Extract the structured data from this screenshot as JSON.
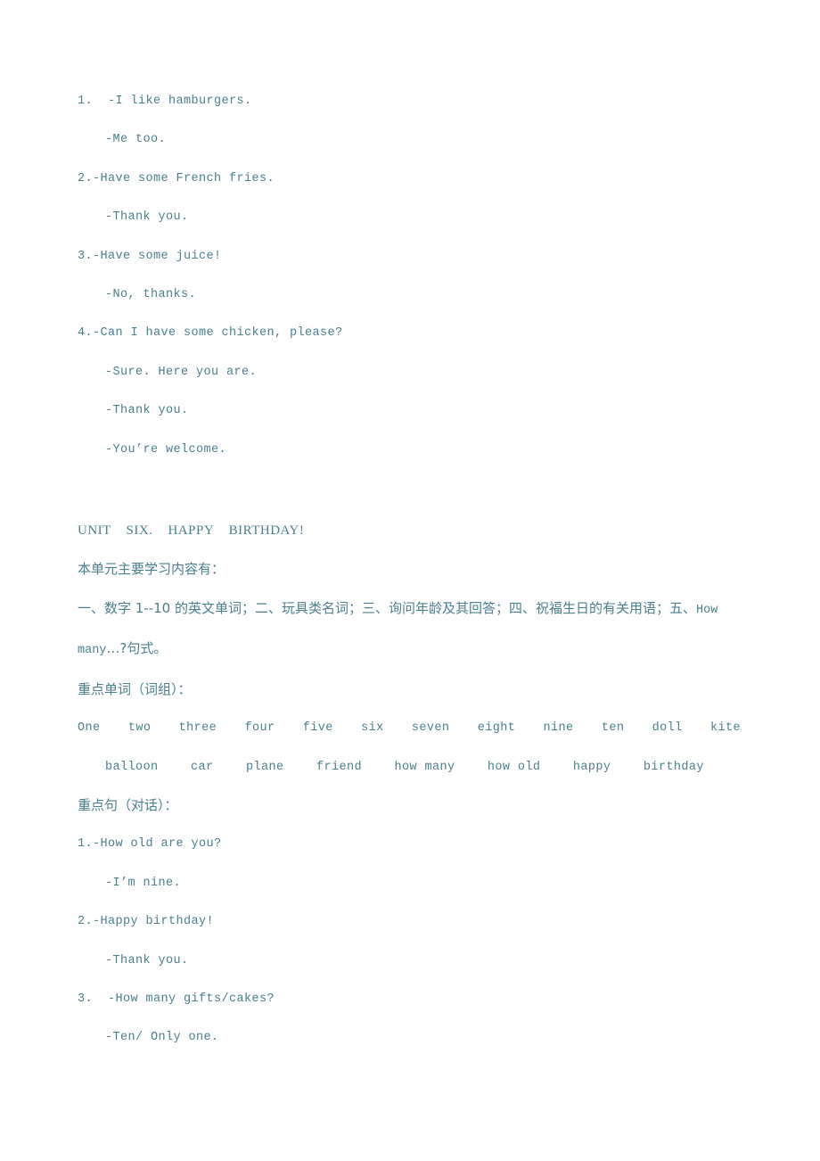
{
  "document": {
    "text_color": "#4d7f8e",
    "background_color": "#ffffff"
  },
  "dialogue_block_1": {
    "items": [
      {
        "prompt": "1.  -I like hamburgers.",
        "replies": [
          "-Me too."
        ]
      },
      {
        "prompt": "2.-Have some French fries.",
        "replies": [
          "-Thank you."
        ]
      },
      {
        "prompt": "3.-Have some juice!",
        "replies": [
          "-No, thanks."
        ]
      },
      {
        "prompt": "4.-Can I have some chicken, please?",
        "replies": [
          "-Sure. Here you are.",
          "-Thank you.",
          "-You’re welcome."
        ]
      }
    ]
  },
  "unit": {
    "heading": "UNIT    SIX.    HAPPY    BIRTHDAY!",
    "intro_label": "本单元主要学习内容有：",
    "contents_part1": "一、数字 1--10 的英文单词；二、玩具类名词；三、询问年龄及其回答；四、祝福生日的有关用语；五、",
    "contents_part2_en": "How many",
    "contents_part2_cn": "…?句式。"
  },
  "vocabulary": {
    "label": "重点单词（词组）：",
    "row1": [
      "One",
      "two",
      "three",
      "four",
      "five",
      "six",
      "seven",
      "eight",
      "nine",
      "ten",
      "doll",
      "kite"
    ],
    "row2": [
      "balloon",
      "car",
      "plane",
      "friend",
      "how many",
      "how old",
      "happy",
      "birthday"
    ]
  },
  "dialogue_block_2": {
    "label": "重点句（对话）：",
    "items": [
      {
        "prompt": "1.-How old are you?",
        "replies": [
          "-I’m nine."
        ]
      },
      {
        "prompt": "2.-Happy birthday!",
        "replies": [
          "-Thank you."
        ]
      },
      {
        "prompt": "3.  -How many gifts/cakes?",
        "replies": [
          "-Ten/ Only one."
        ]
      }
    ]
  }
}
